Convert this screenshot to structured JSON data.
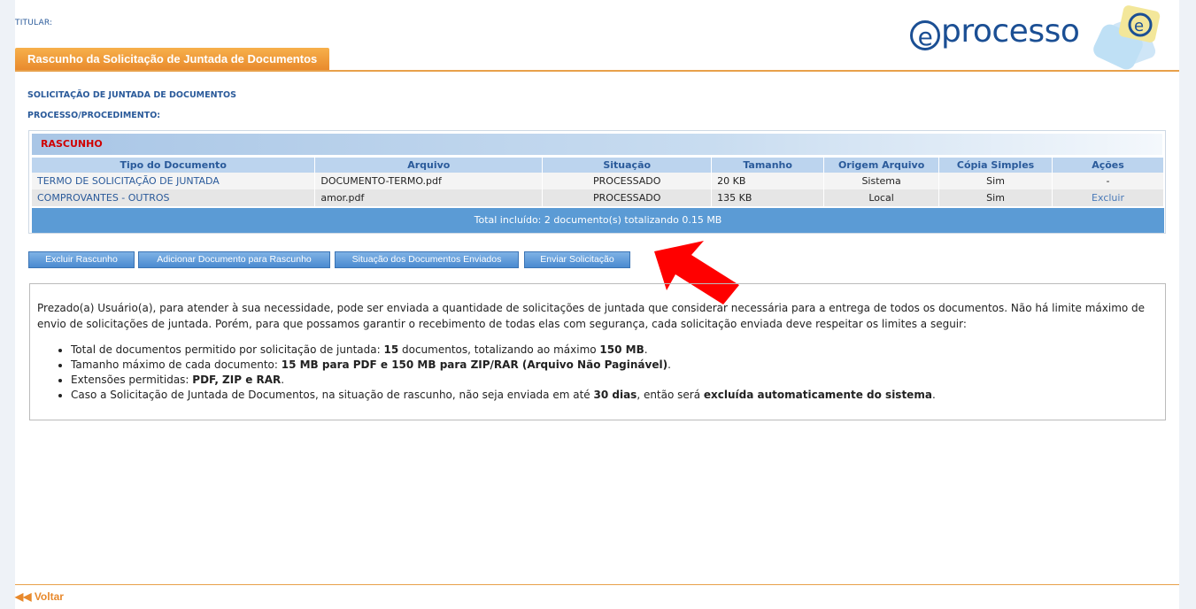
{
  "header": {
    "titular_label": "TITULAR:",
    "logo_e": "e",
    "logo_text": "processo",
    "tab_title": "Rascunho da Solicitação de Juntada de Documentos"
  },
  "labels": {
    "solicitacao": "SOLICITAÇÃO DE JUNTADA DE DOCUMENTOS",
    "processo": "PROCESSO/PROCEDIMENTO:"
  },
  "rascunho": {
    "title": "RASCUNHO",
    "columns": [
      "Tipo do Documento",
      "Arquivo",
      "Situação",
      "Tamanho",
      "Origem Arquivo",
      "Cópia Simples",
      "Ações"
    ],
    "rows": [
      {
        "tipo": "TERMO DE SOLICITAÇÃO DE JUNTADA",
        "arquivo": "DOCUMENTO-TERMO.pdf",
        "situacao": "PROCESSADO",
        "tamanho": "20 KB",
        "origem": "Sistema",
        "copia": "Sim",
        "acoes": "-"
      },
      {
        "tipo": "COMPROVANTES - OUTROS",
        "arquivo": "amor.pdf",
        "situacao": "PROCESSADO",
        "tamanho": "135 KB",
        "origem": "Local",
        "copia": "Sim",
        "acoes": "Excluir"
      }
    ],
    "total": "Total incluído: 2 documento(s) totalizando 0.15 MB"
  },
  "buttons": {
    "excluir": "Excluir Rascunho",
    "adicionar": "Adicionar Documento para Rascunho",
    "situacao": "Situação dos Documentos Enviados",
    "enviar": "Enviar Solicitação"
  },
  "info": {
    "intro": "Prezado(a) Usuário(a), para atender à sua necessidade, pode ser enviada a quantidade de solicitações de juntada que considerar necessária para a entrega de todos os documentos. Não há limite máximo de envio de solicitações de juntada. Porém, para que possamos garantir o recebimento de todas elas com segurança, cada solicitação enviada deve respeitar os limites a seguir:",
    "b1_pre": "Total de documentos permitido por solicitação de juntada: ",
    "b1_bold1": "15",
    "b1_mid": " documentos, totalizando ao máximo ",
    "b1_bold2": "150 MB",
    "b1_end": ".",
    "b2_pre": "Tamanho máximo de cada documento: ",
    "b2_bold": "15 MB para PDF e 150 MB para ZIP/RAR (Arquivo Não Paginável)",
    "b2_end": ".",
    "b3_pre": "Extensões permitidas: ",
    "b3_bold": "PDF, ZIP e RAR",
    "b3_end": ".",
    "b4_pre": "Caso a Solicitação de Juntada de Documentos, na situação de rascunho, não seja enviada em até ",
    "b4_bold1": "30 dias",
    "b4_mid": ", então será ",
    "b4_bold2": "excluída automaticamente do sistema",
    "b4_end": "."
  },
  "footer": {
    "back": "Voltar"
  },
  "colors": {
    "accent_orange": "#e8892c",
    "link_blue": "#2a5a9a",
    "button_blue": "#4a8ad0",
    "total_bar": "#5b9bd5",
    "draft_red": "#d00000",
    "arrow_red": "#ff0000"
  },
  "icons": {
    "back": "double-left-arrow-icon",
    "pointer": "red-arrow-pointer-icon"
  }
}
